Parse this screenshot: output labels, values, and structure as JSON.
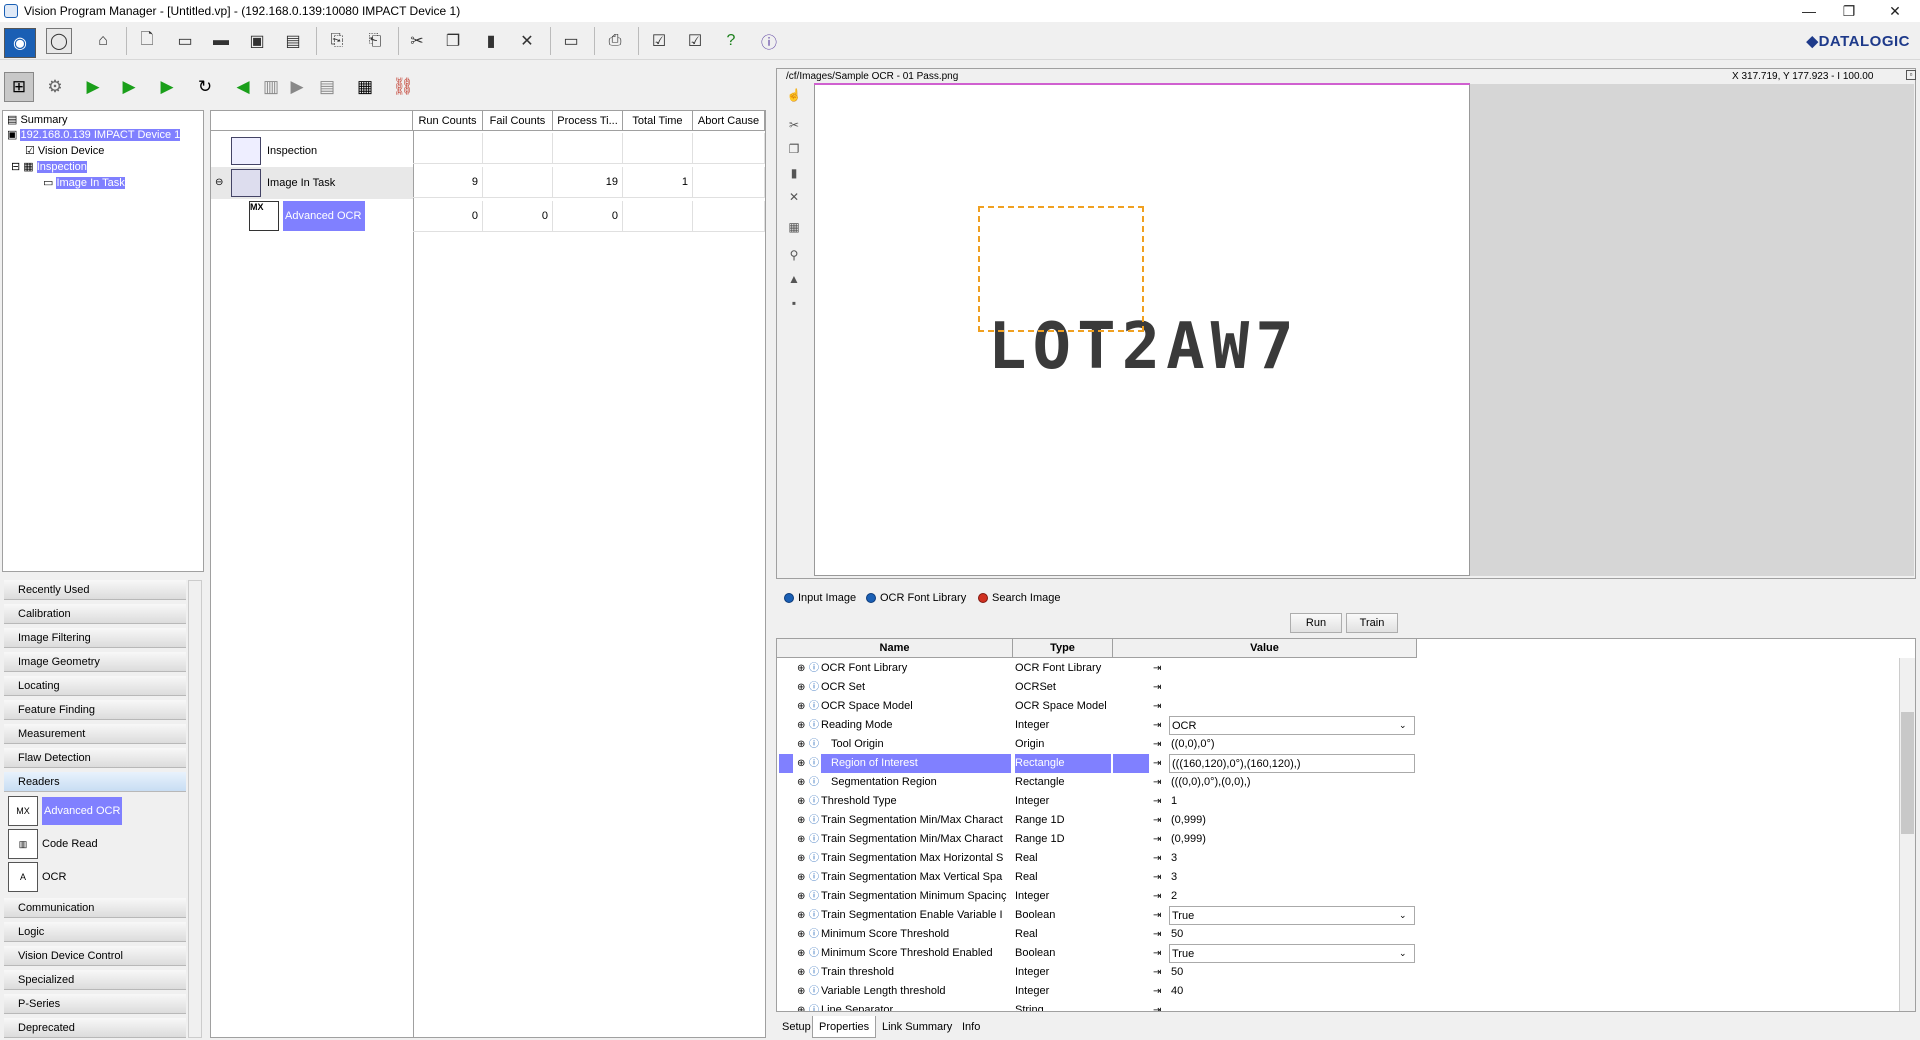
{
  "window": {
    "title": "Vision Program Manager - [Untitled.vp] - (192.168.0.139:10080 IMPACT Device 1)",
    "logo": "◆DATALOGIC"
  },
  "tree": {
    "items": [
      "Summary",
      "192.168.0.139 IMPACT Device 1",
      "Vision Device",
      "Inspection",
      "Image In Task"
    ]
  },
  "grid": {
    "headers": [
      "Run Counts",
      "Fail Counts",
      "Process Ti...",
      "Total Time",
      "Abort Cause"
    ],
    "rows": [
      {
        "name": "Inspection",
        "vals": [
          "",
          "",
          "",
          "",
          ""
        ]
      },
      {
        "name": "Image In Task",
        "vals": [
          "9",
          "",
          "19",
          "1",
          ""
        ]
      },
      {
        "name": "Advanced OCR",
        "vals": [
          "0",
          "0",
          "0",
          "",
          ""
        ]
      }
    ]
  },
  "categories": [
    "Recently Used",
    "Calibration",
    "Image Filtering",
    "Image Geometry",
    "Locating",
    "Feature Finding",
    "Measurement",
    "Flaw Detection",
    "Readers",
    "Communication",
    "Logic",
    "Vision Device Control",
    "Specialized",
    "P-Series",
    "Deprecated"
  ],
  "reader_tools": [
    "Advanced OCR",
    "Code Read",
    "OCR"
  ],
  "image": {
    "path": "/cf/Images/Sample OCR - 01 Pass.png",
    "coords": "X 317.719,  Y 177.923  -  I 100.00",
    "ocr_text": "LOT2AW7"
  },
  "image_tabs": [
    "Input Image",
    "OCR Font Library",
    "Search Image"
  ],
  "buttons": {
    "run": "Run",
    "train": "Train"
  },
  "props": {
    "headers": [
      "Name",
      "Type",
      "Value"
    ],
    "rows": [
      {
        "name": "OCR Font Library",
        "type": "OCR Font Library",
        "value": ""
      },
      {
        "name": "OCR Set",
        "type": "OCRSet",
        "value": ""
      },
      {
        "name": "OCR Space Model",
        "type": "OCR Space Model",
        "value": ""
      },
      {
        "name": "Reading Mode",
        "type": "Integer",
        "value": "OCR"
      },
      {
        "name": "Tool Origin",
        "type": "Origin",
        "value": "((0,0),0°)"
      },
      {
        "name": "Region of Interest",
        "type": "Rectangle",
        "value": "(((160,120),0°),(160,120),)"
      },
      {
        "name": "Segmentation Region",
        "type": "Rectangle",
        "value": "(((0,0),0°),(0,0),)"
      },
      {
        "name": "Threshold Type",
        "type": "Integer",
        "value": "1"
      },
      {
        "name": "Train Segmentation Min/Max Charact",
        "type": "Range 1D",
        "value": "(0,999)"
      },
      {
        "name": "Train Segmentation Min/Max Charact",
        "type": "Range 1D",
        "value": "(0,999)"
      },
      {
        "name": "Train Segmentation Max Horizontal S",
        "type": "Real",
        "value": "3"
      },
      {
        "name": "Train Segmentation Max Vertical Spa",
        "type": "Real",
        "value": "3"
      },
      {
        "name": "Train Segmentation Minimum Spacinç",
        "type": "Integer",
        "value": "2"
      },
      {
        "name": "Train Segmentation Enable Variable I",
        "type": "Boolean",
        "value": "True"
      },
      {
        "name": "Minimum Score Threshold",
        "type": "Real",
        "value": "50"
      },
      {
        "name": "Minimum Score Threshold Enabled",
        "type": "Boolean",
        "value": "True"
      },
      {
        "name": "Train threshold",
        "type": "Integer",
        "value": "50"
      },
      {
        "name": "Variable Length threshold",
        "type": "Integer",
        "value": "40"
      },
      {
        "name": "Line Separator",
        "type": "String",
        "value": ""
      }
    ]
  },
  "bottom_tabs": [
    "Setup",
    "Properties",
    "Link Summary",
    "Info"
  ]
}
